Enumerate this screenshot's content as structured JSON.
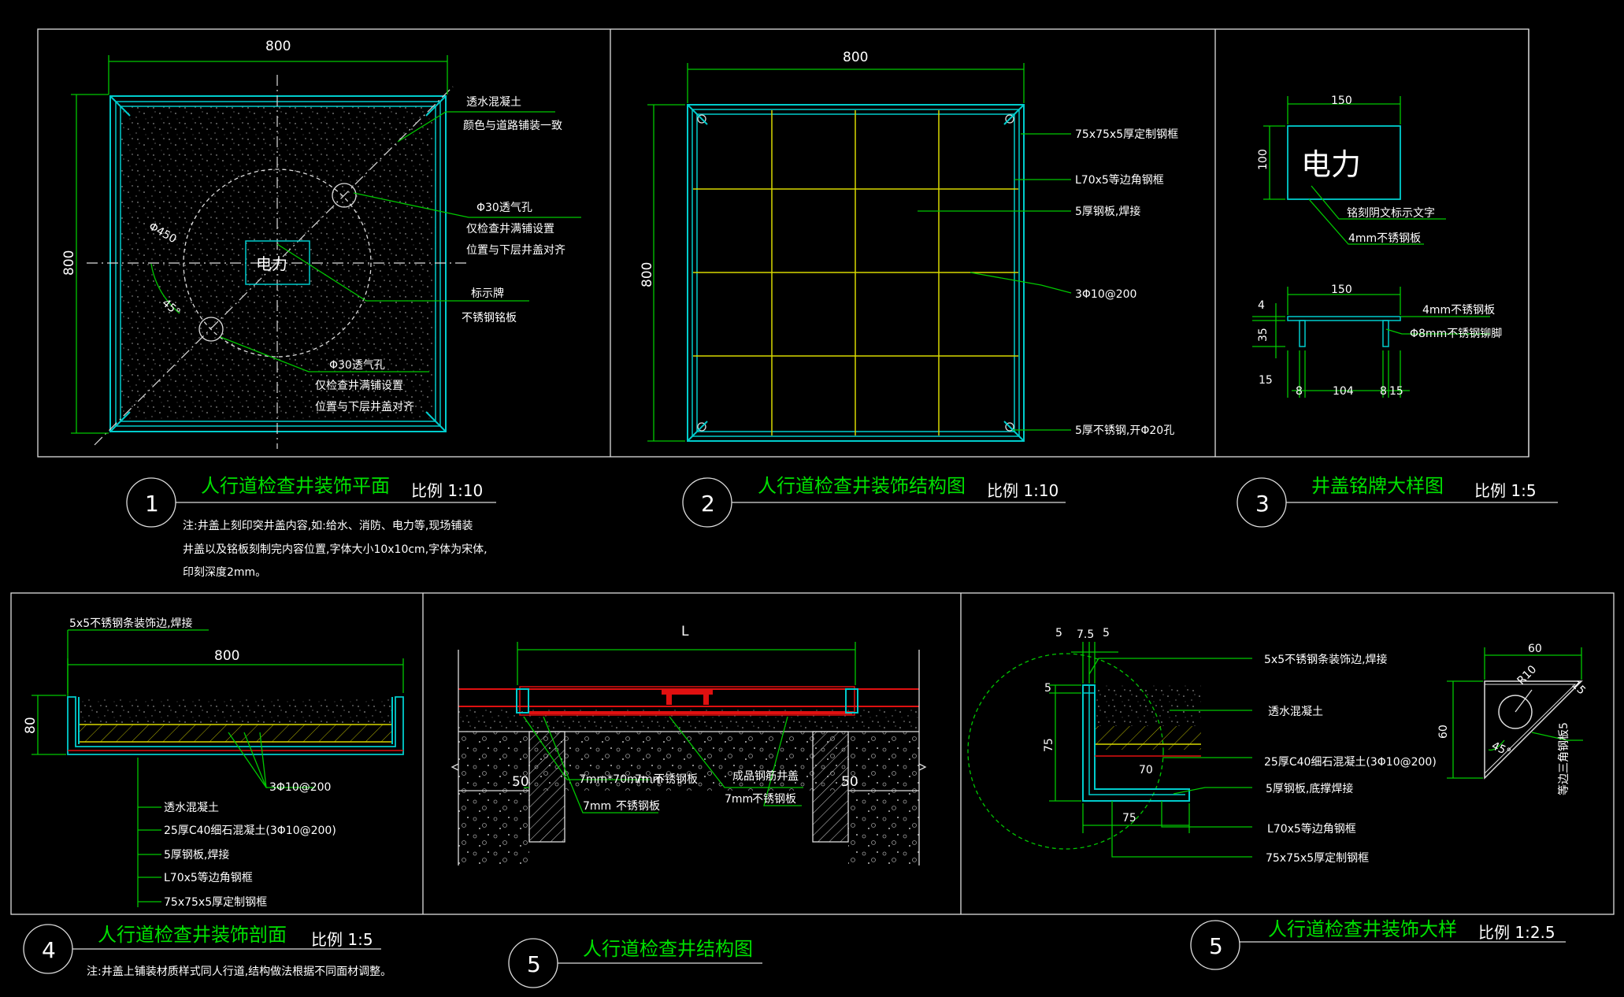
{
  "colors": {
    "background": "#000000",
    "green": "#00c800",
    "cyan": "#00cccc",
    "yellow": "#d8d800",
    "red": "#e01010",
    "white": "#ffffff"
  },
  "d1": {
    "num": "1",
    "title": "人行道检查井装饰平面",
    "scale": "比例 1:10",
    "dim_w": "800",
    "dim_h": "800",
    "phi": "Φ450",
    "angle": "45°",
    "sign": "电力",
    "labels": [
      "透水混凝土",
      "颜色与道路铺装一致",
      "Φ30透气孔",
      "仅检查井满铺设置",
      "位置与下层井盖对齐",
      "标示牌",
      "不锈钢铭板",
      "Φ30透气孔",
      "仅检查井满铺设置",
      "位置与下层井盖对齐"
    ],
    "notes": [
      "注:井盖上刻印突井盖内容,如:给水、消防、电力等,现场铺装",
      "井盖以及铭板刻制完内容位置,字体大小10x10cm,字体为宋体,",
      "印刻深度2mm。"
    ]
  },
  "d2": {
    "num": "2",
    "title": "人行道检查井装饰结构图",
    "scale": "比例 1:10",
    "dim_w": "800",
    "dim_h": "800",
    "labels": [
      "75x75x5厚定制钢框",
      "L70x5等边角钢框",
      "5厚钢板,焊接",
      "3Φ10@200",
      "5厚不锈钢,开Φ20孔"
    ]
  },
  "d3": {
    "num": "3",
    "title": "井盖铭牌大样图",
    "scale": "比例 1:5",
    "dim_top": "150",
    "dim_side": "100",
    "sign": "电力",
    "labels": [
      "铭刻阴文标示文字",
      "4mm不锈钢板",
      "4mm不锈钢板",
      "Φ8mm不锈钢铆脚"
    ],
    "dim_top2": "150",
    "dims_left": [
      "4",
      "35",
      "15"
    ],
    "dims_bottom": [
      "8",
      "104",
      "8",
      "15"
    ]
  },
  "d4": {
    "num": "4",
    "title": "人行道检查井装饰剖面",
    "scale": "比例 1:5",
    "dim_w": "800",
    "dim_h": "80",
    "top_label": "5x5不锈钢条装饰边,焊接",
    "rebar": "3Φ10@200",
    "labels": [
      "透水混凝土",
      "25厚C40细石混凝土(3Φ10@200)",
      "5厚钢板,焊接",
      "L70x5等边角钢框",
      "75x75x5厚定制钢框"
    ],
    "note": "注:井盖上铺装材质样式同人行道,结构做法根据不同面材调整。"
  },
  "d5a": {
    "num": "5",
    "title": "人行道检查井结构图",
    "dim_L": "L",
    "dim_50a": "50",
    "dim_50b": "50",
    "labels": [
      "7mm*70mm",
      "7mm",
      "不锈钢板",
      "7mm",
      "不锈钢板",
      "成品钢筋井盖",
      "7mm",
      "不锈钢板"
    ]
  },
  "d5b": {
    "num": "5",
    "title": "人行道检查井装饰大样",
    "scale": "比例 1:2.5",
    "dims_top": [
      "5",
      "7.5",
      "5"
    ],
    "dim_5": "5",
    "dim_75v": "75",
    "dim_70": "70",
    "dim_75h": "75",
    "labels": [
      "5x5不锈钢条装饰边,焊接",
      "透水混凝土",
      "25厚C40细石混凝土(3Φ10@200)",
      "5厚钢板,底撑焊接",
      "L70x5等边角钢框",
      "75x75x5厚定制钢框"
    ],
    "corner_top": "60",
    "corner_left": "60",
    "corner_r": "R10",
    "corner_d": "15",
    "corner_angle": "45°",
    "corner_note": "等边三角钢板5"
  }
}
